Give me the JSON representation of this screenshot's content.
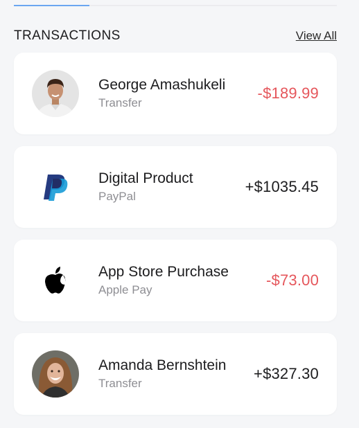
{
  "header": {
    "title": "TRANSACTIONS",
    "view_all_label": "View All"
  },
  "transactions": [
    {
      "title": "George Amashukeli",
      "subtitle": "Transfer",
      "amount": "-$189.99",
      "type": "debit",
      "icon": "avatar-photo"
    },
    {
      "title": "Digital Product",
      "subtitle": "PayPal",
      "amount": "+$1035.45",
      "type": "credit",
      "icon": "paypal-icon"
    },
    {
      "title": "App Store Purchase",
      "subtitle": "Apple Pay",
      "amount": "-$73.00",
      "type": "debit",
      "icon": "apple-icon"
    },
    {
      "title": "Amanda Bernshtein",
      "subtitle": "Transfer",
      "amount": "+$327.30",
      "type": "credit",
      "icon": "avatar-photo"
    }
  ],
  "colors": {
    "debit": "#e5565b",
    "credit": "#1c1c1e",
    "tab_accent": "#6aa6f0",
    "paypal_dark": "#253b80",
    "paypal_light": "#179bd7"
  }
}
